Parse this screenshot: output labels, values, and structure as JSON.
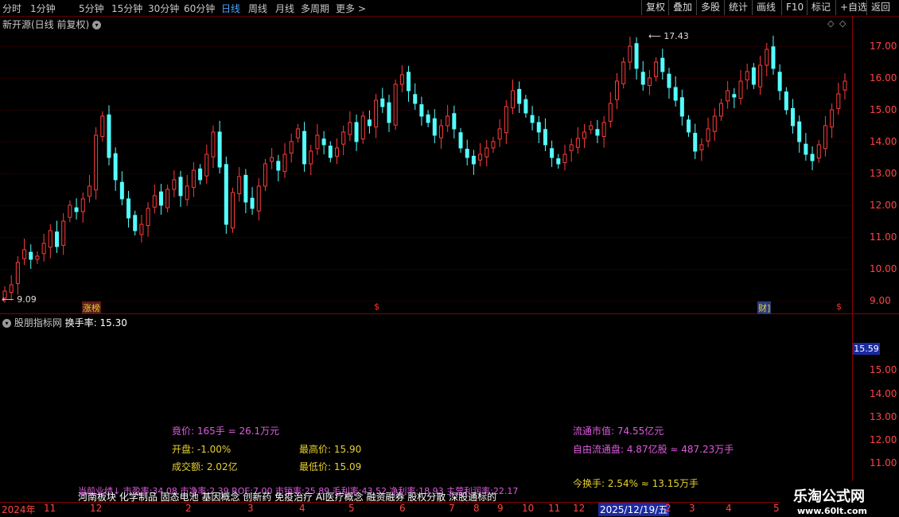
{
  "toolbar": {
    "tabs": [
      "分时",
      "1分钟",
      "5分钟",
      "15分钟",
      "30分钟",
      "60分钟",
      "日线",
      "周线",
      "月线",
      "多周期",
      "更多 >"
    ],
    "active_tab": "日线",
    "right_buttons": [
      "复权",
      "叠加",
      "多股",
      "统计",
      "画线",
      "F10",
      "标记",
      "+自选",
      "返回"
    ]
  },
  "main_panel": {
    "stock_title": "新开源(日线 前复权)",
    "high_label": "17.43",
    "low_label": "9.09",
    "price_axis": [
      "17.00",
      "16.00",
      "15.00",
      "14.00",
      "13.00",
      "12.00",
      "11.00",
      "10.00",
      "9.00"
    ],
    "markers": {
      "zhangbang": "涨榜",
      "s1": "$",
      "caibao": "财]",
      "s2": "$"
    }
  },
  "sub_panel": {
    "title": "股朋指标网",
    "indicator": "换手率: 15.30",
    "axis_badge": "15.59",
    "axis": [
      "15.00",
      "14.00",
      "13.00",
      "12.00",
      "11.00"
    ]
  },
  "info": {
    "bid": "竟价: 165手 = 26.1万元",
    "open": "开盘: -1.00%",
    "high": "最高价: 15.90",
    "turnover": "成交额: 2.02亿",
    "low": "最低价: 15.09",
    "mkt_cap": "流通市值: 74.55亿元",
    "free_float": "自由流通盘: 4.87亿股 ≈ 487.23万手",
    "today_turnover": "今换手: 2.54% ≈ 13.15万手",
    "fundamentals": "当前业绩↓   市盈率:34.08  市净率:2.39  ROE:7.00  市销率:25.89  毛利率:43.52  净利率:18.93  主营利润率:22.17",
    "concepts": "河南板块 化学制品 固态电池 基因概念 创新药 免疫治疗 AI医疗概念 融资融券 股权分散 深股通标的"
  },
  "date_axis": {
    "labels": [
      "2024年",
      "11",
      "12",
      "2",
      "3",
      "4",
      "5",
      "6",
      "7",
      "8",
      "9",
      "10",
      "11",
      "12",
      "2025/12/19/五",
      "2",
      "3",
      "4",
      "5"
    ]
  },
  "logo": {
    "name": "乐淘公式网",
    "url": "www.60lt.com"
  },
  "chart_data": {
    "type": "candlestick",
    "title": "新开源(日线 前复权)",
    "y_axis": [
      9,
      17.5
    ],
    "close_series": [
      9.3,
      9.5,
      10.2,
      10.6,
      10.3,
      10.4,
      10.8,
      11.2,
      10.7,
      11.5,
      12.0,
      11.8,
      12.2,
      12.6,
      14.2,
      14.8,
      13.5,
      12.8,
      12.2,
      11.6,
      11.2,
      11.4,
      11.9,
      12.3,
      12.0,
      12.5,
      12.8,
      12.3,
      12.6,
      13.1,
      12.8,
      13.6,
      14.3,
      13.2,
      11.4,
      12.4,
      12.9,
      12.1,
      11.9,
      12.6,
      13.3,
      13.5,
      13.1,
      13.6,
      14.0,
      14.4,
      13.3,
      13.7,
      14.2,
      13.9,
      13.5,
      13.8,
      14.3,
      14.6,
      14.0,
      14.8,
      14.5,
      15.3,
      15.1,
      14.6,
      15.8,
      16.1,
      15.6,
      15.2,
      14.8,
      14.6,
      14.2,
      14.5,
      14.8,
      14.4,
      13.8,
      13.5,
      13.3,
      13.6,
      13.8,
      14.0,
      14.4,
      15.1,
      15.6,
      15.2,
      14.9,
      14.6,
      14.3,
      13.9,
      13.5,
      13.3,
      13.6,
      13.9,
      14.1,
      14.3,
      14.5,
      14.2,
      14.6,
      15.2,
      15.9,
      16.5,
      17.0,
      16.3,
      15.8,
      16.0,
      16.5,
      16.2,
      15.7,
      15.3,
      14.8,
      14.3,
      13.7,
      13.9,
      14.4,
      14.8,
      15.2,
      15.6,
      15.4,
      15.9,
      16.2,
      15.8,
      16.4,
      16.9,
      16.3,
      15.6,
      15.0,
      14.5,
      14.0,
      13.6,
      13.4,
      13.9,
      14.5,
      15.0,
      15.5,
      15.9
    ]
  }
}
